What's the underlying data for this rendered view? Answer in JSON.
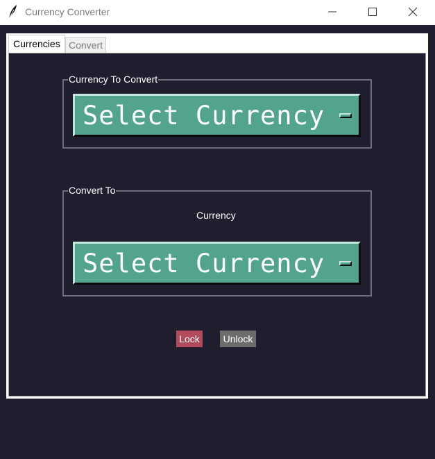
{
  "window": {
    "title": "Currency Converter",
    "icon": "feather-icon",
    "controls": [
      "minimize-icon",
      "maximize-icon",
      "close-icon"
    ]
  },
  "tabs": [
    {
      "label": "Currencies",
      "active": true
    },
    {
      "label": "Convert",
      "active": false
    }
  ],
  "currencies_tab": {
    "from_frame": {
      "label": "Currency To Convert",
      "dropdown": {
        "selected": "Select Currency"
      }
    },
    "to_frame": {
      "label": "Convert To",
      "caption": "Currency",
      "dropdown": {
        "selected": "Select Currency"
      }
    },
    "buttons": {
      "lock": "Lock",
      "unlock": "Unlock"
    }
  },
  "colors": {
    "background": "#1f1e2e",
    "dropdown": "#52a48f",
    "lock_button": "#b14b5b",
    "unlock_button": "#6c6c6c",
    "frame_border": "#6e6c78"
  }
}
